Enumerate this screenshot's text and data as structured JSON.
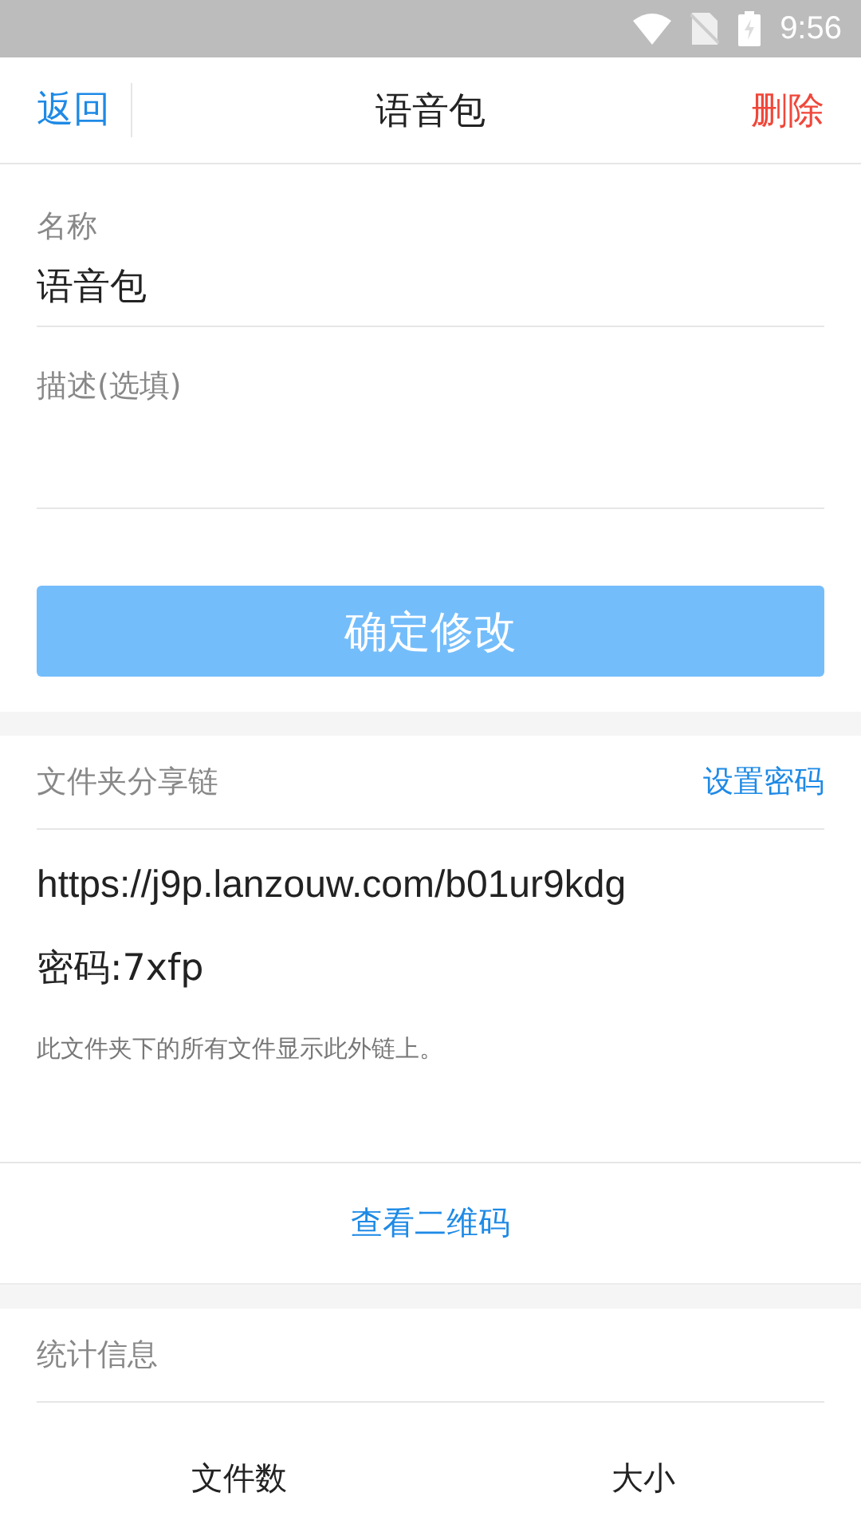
{
  "status_bar": {
    "time": "9:56"
  },
  "header": {
    "back": "返回",
    "title": "语音包",
    "delete": "删除"
  },
  "form": {
    "fields": [
      {
        "label": "名称",
        "value": "语音包"
      },
      {
        "label": "描述(选填)"
      }
    ],
    "submit": "确定修改"
  },
  "share": {
    "title": "文件夹分享链",
    "set_password": "设置密码",
    "url": "https://j9p.lanzouw.com/b01ur9kdg",
    "password": "密码:7xfp",
    "note": "此文件夹下的所有文件显示此外链上。",
    "qr_button": "查看二维码"
  },
  "stats": {
    "title": "统计信息",
    "columns": [
      "文件数",
      "大小"
    ]
  }
}
